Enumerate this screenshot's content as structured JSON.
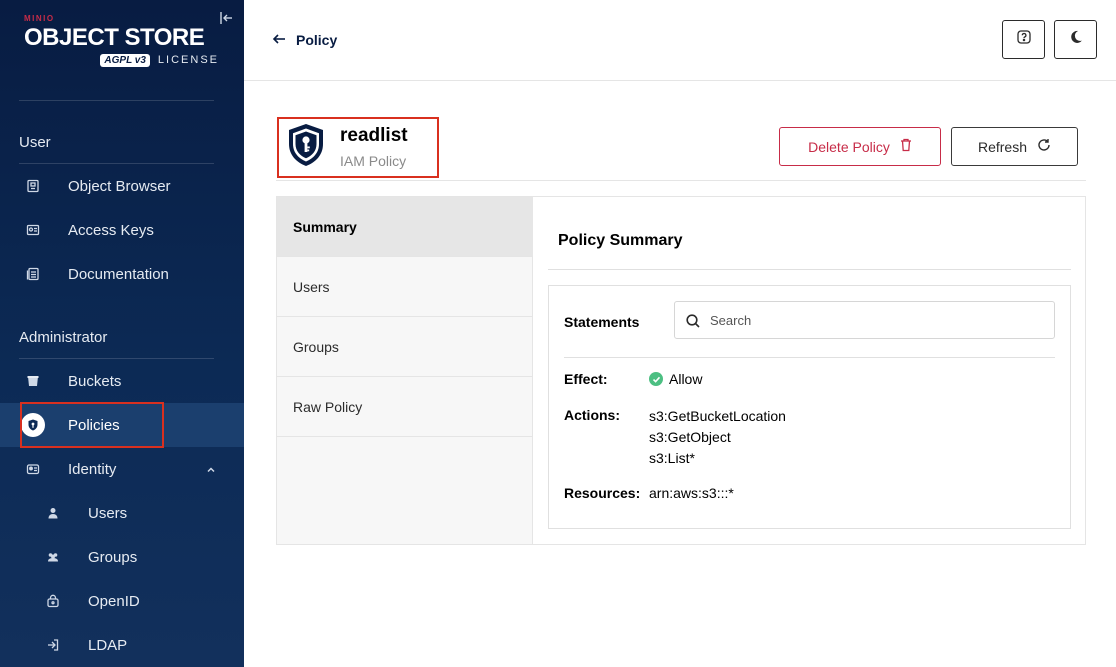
{
  "sidebar": {
    "logo": {
      "brand": "MINIO",
      "title": "OBJECT STORE",
      "badge": "AGPL v3",
      "license": "LICENSE"
    },
    "sections": {
      "user": "User",
      "admin": "Administrator"
    },
    "items": [
      {
        "label": "Object Browser",
        "icon": "object-browser-icon"
      },
      {
        "label": "Access Keys",
        "icon": "access-keys-icon"
      },
      {
        "label": "Documentation",
        "icon": "documentation-icon"
      },
      {
        "label": "Buckets",
        "icon": "buckets-icon"
      },
      {
        "label": "Policies",
        "icon": "policies-icon",
        "active": true
      },
      {
        "label": "Identity",
        "icon": "identity-icon",
        "expanded": true
      },
      {
        "label": "Users",
        "icon": "user-icon"
      },
      {
        "label": "Groups",
        "icon": "groups-icon"
      },
      {
        "label": "OpenID",
        "icon": "openid-icon"
      },
      {
        "label": "LDAP",
        "icon": "ldap-icon"
      }
    ]
  },
  "header": {
    "back_label": "Policy"
  },
  "policy": {
    "name": "readlist",
    "type": "IAM Policy"
  },
  "actions": {
    "delete": "Delete Policy",
    "refresh": "Refresh"
  },
  "tabs": [
    {
      "label": "Summary",
      "active": true
    },
    {
      "label": "Users"
    },
    {
      "label": "Groups"
    },
    {
      "label": "Raw Policy"
    }
  ],
  "summary": {
    "title": "Policy Summary",
    "statements_label": "Statements",
    "search_placeholder": "Search",
    "effect_label": "Effect:",
    "effect_value": "Allow",
    "actions_label": "Actions:",
    "actions": [
      "s3:GetBucketLocation",
      "s3:GetObject",
      "s3:List*"
    ],
    "resources_label": "Resources:",
    "resources_value": "arn:aws:s3:::*"
  },
  "colors": {
    "sidebar": "#0c2a55",
    "accent_red": "#c72c48",
    "allow_green": "#4cbf82",
    "highlight_box": "#d9301f"
  }
}
